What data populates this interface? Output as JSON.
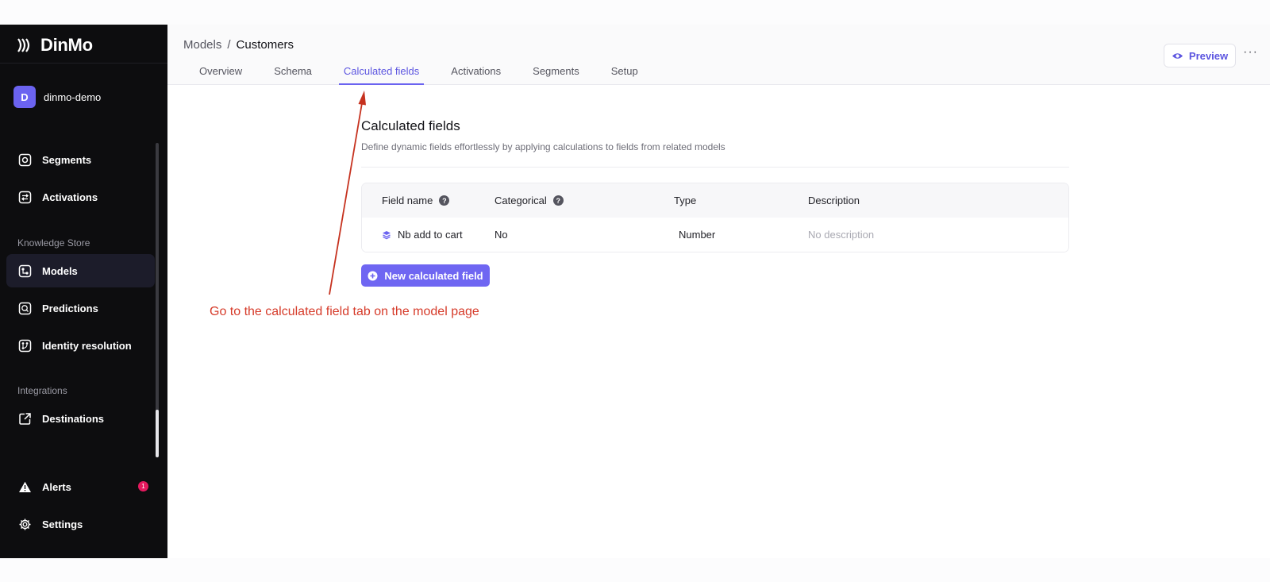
{
  "sidebar": {
    "brand": "DinMo",
    "workspace": {
      "initial": "D",
      "name": "dinmo-demo"
    },
    "items": [
      {
        "label": "Segments",
        "icon": "segments-icon"
      },
      {
        "label": "Activations",
        "icon": "activations-icon"
      },
      {
        "label": "Models",
        "icon": "models-icon",
        "active": true
      },
      {
        "label": "Predictions",
        "icon": "predictions-icon"
      },
      {
        "label": "Identity resolution",
        "icon": "identity-resolution-icon"
      },
      {
        "label": "Destinations",
        "icon": "destinations-icon"
      },
      {
        "label": "Alerts",
        "icon": "alert-icon",
        "badge": "1"
      },
      {
        "label": "Settings",
        "icon": "gear-icon"
      }
    ],
    "sections": {
      "knowledge": "Knowledge Store",
      "integrations": "Integrations"
    }
  },
  "header": {
    "breadcrumb": {
      "parent": "Models",
      "separator": "/",
      "current": "Customers"
    },
    "tabs": [
      "Overview",
      "Schema",
      "Calculated fields",
      "Activations",
      "Segments",
      "Setup"
    ],
    "active_tab": "Calculated fields",
    "preview_label": "Preview",
    "more_label": "···"
  },
  "main": {
    "title": "Calculated fields",
    "subtitle": "Define dynamic fields effortlessly by applying calculations to fields from related models",
    "table": {
      "headers": [
        "Field name",
        "Categorical",
        "Type",
        "Description"
      ],
      "rows": [
        {
          "field_name": "Nb add to cart",
          "categorical": "No",
          "type": "Number",
          "description": "No description"
        }
      ]
    },
    "new_button": "New calculated field"
  },
  "annotation": "Go to the calculated field tab on the model page",
  "colors": {
    "accent": "#6b63f0",
    "sidebar_bg": "#0d0d0f",
    "annotation": "#d63b2a",
    "badge": "#e5195e"
  }
}
